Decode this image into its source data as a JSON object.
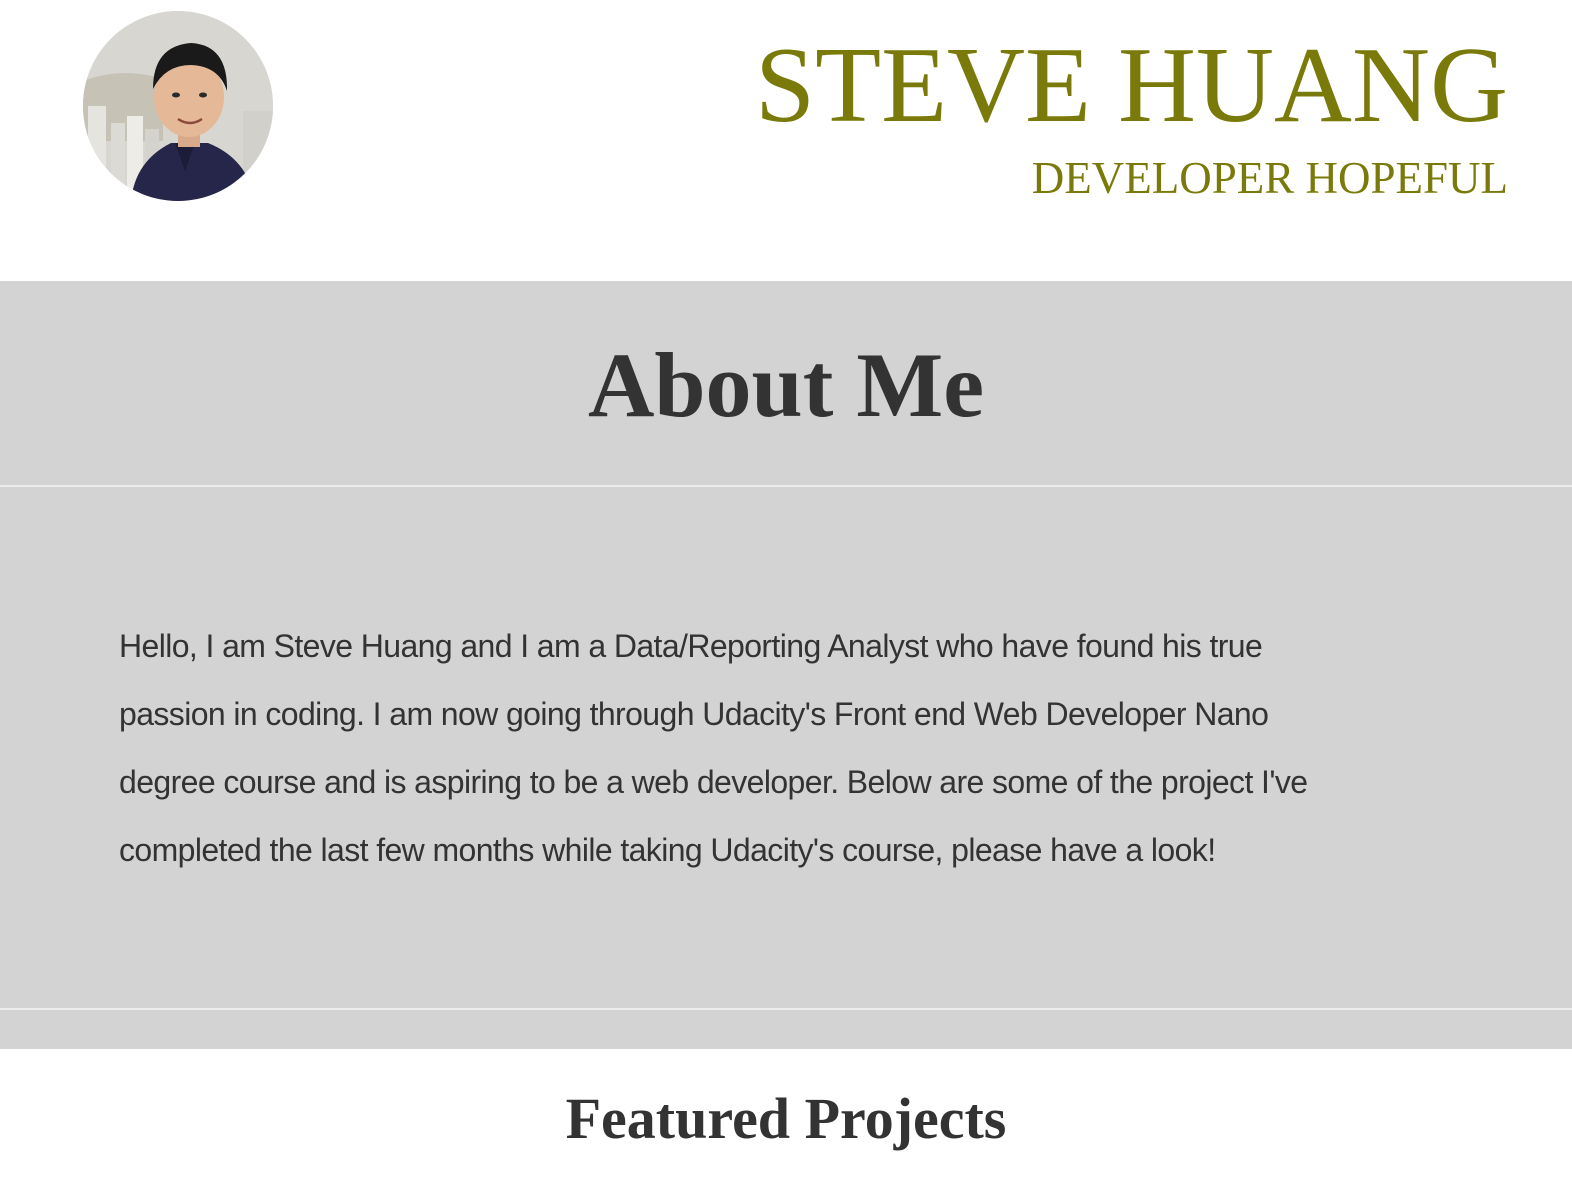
{
  "header": {
    "avatar_icon": "profile-photo",
    "name": "STEVE HUANG",
    "tagline": "DEVELOPER HOPEFUL",
    "accent_color": "#7a7a0a"
  },
  "about": {
    "title": "About Me",
    "lines": [
      "Hello, I am Steve Huang and I am a Data/Reporting Analyst who have found his true",
      "passion in coding. I am now going through Udacity's Front end Web Developer Nano",
      "degree course and is aspiring to be a web developer. Below are some of the project I've",
      "completed the last few months while taking Udacity's course, please have a look!"
    ],
    "background_color": "#d3d3d3"
  },
  "featured": {
    "title": "Featured Projects"
  }
}
